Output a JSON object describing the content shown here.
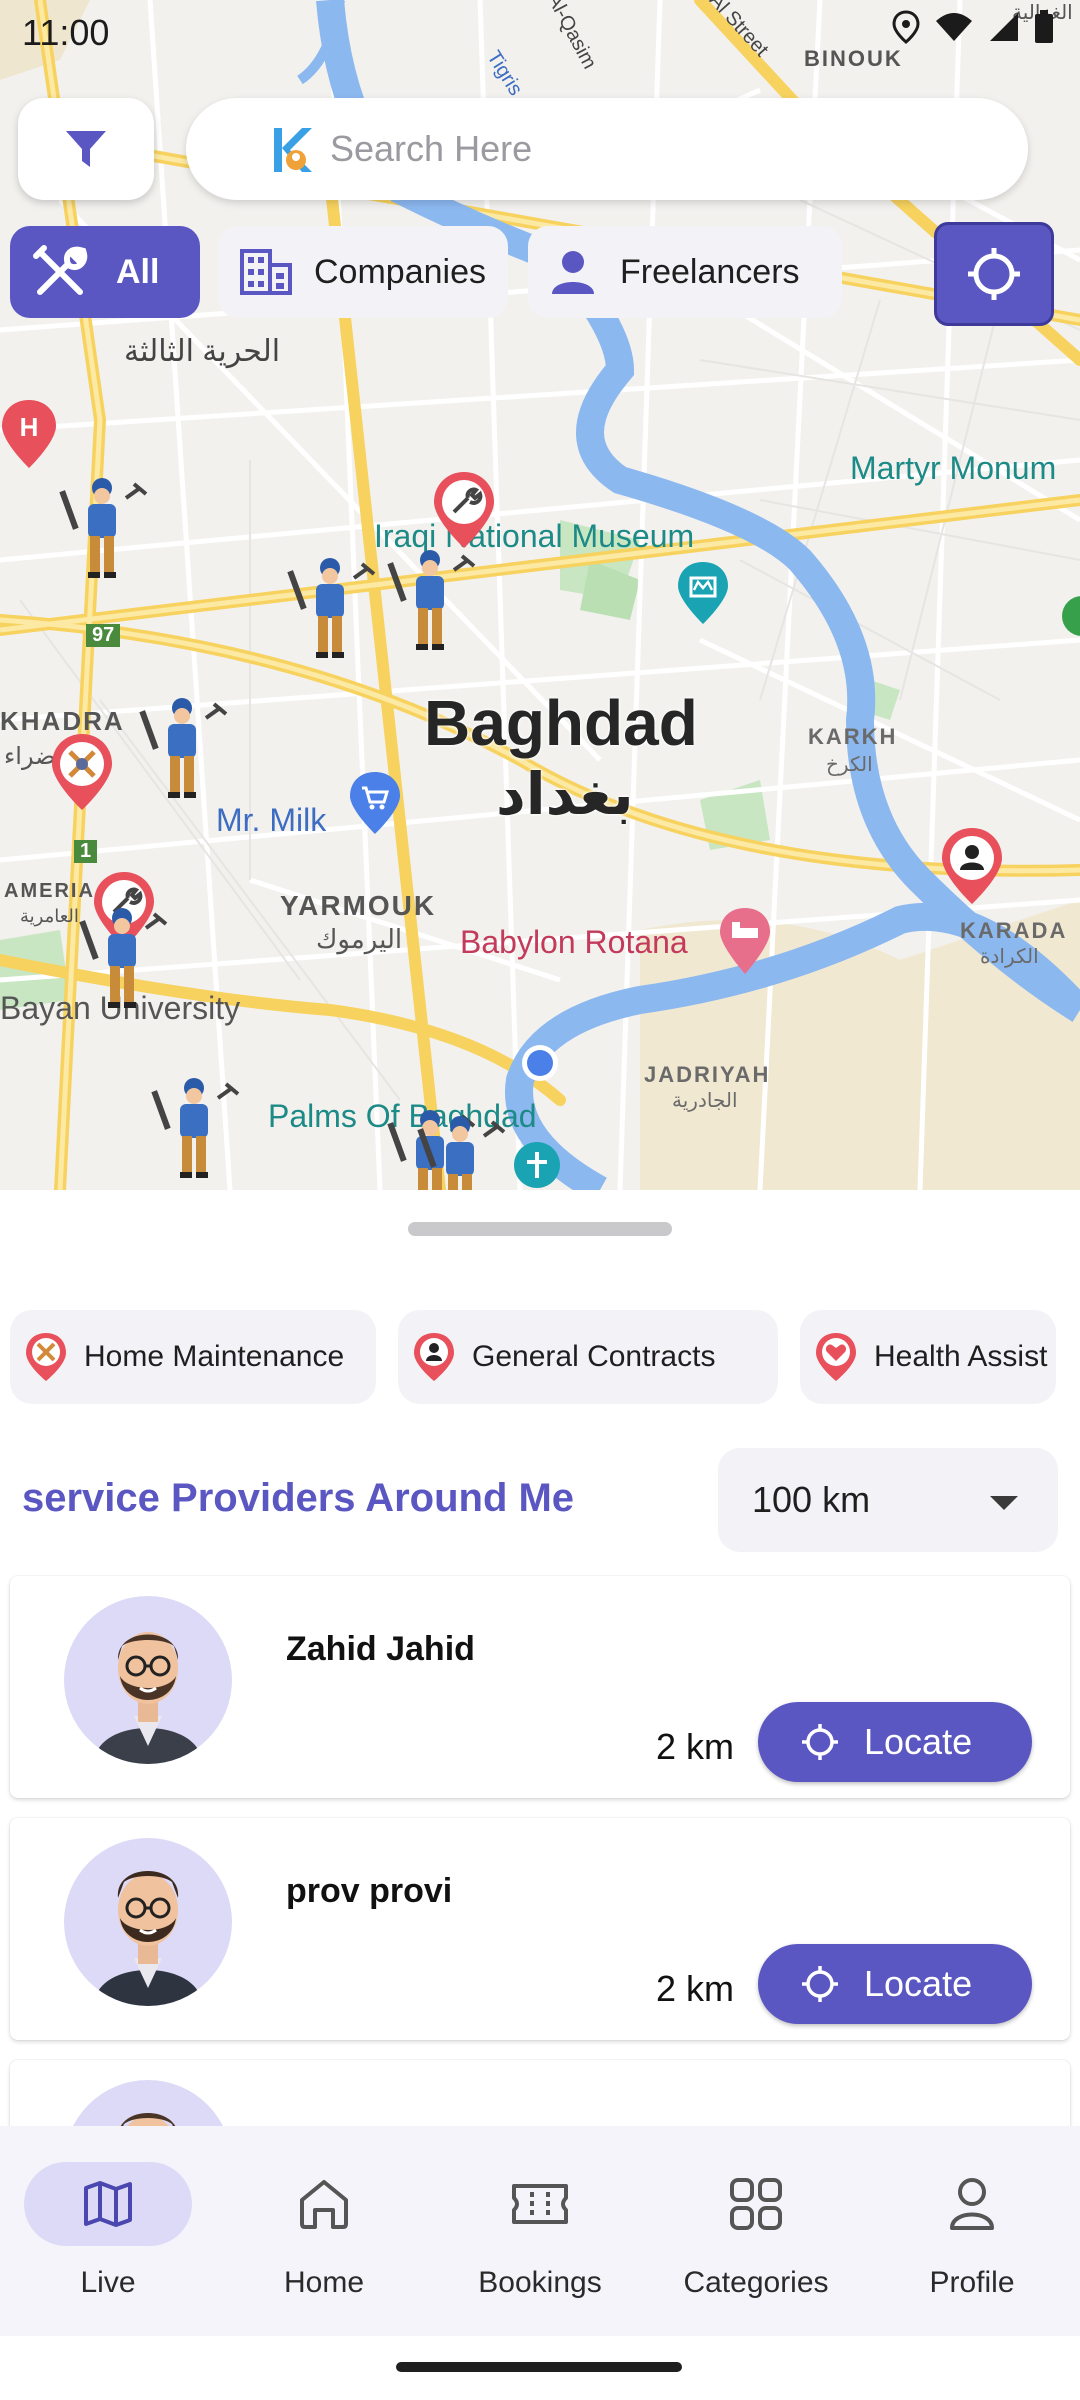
{
  "status_bar": {
    "time": "11:00"
  },
  "search": {
    "placeholder": "Search Here"
  },
  "filters": {
    "all_label": "All",
    "companies_label": "Companies",
    "freelancers_label": "Freelancers"
  },
  "map": {
    "city_name": "Baghdad",
    "city_name_ar": "بغداد",
    "labels": {
      "binouk": "BINOUK",
      "al_hurriya": "الحرية الثالثة",
      "iraqi_museum": "Iraqi National Museum",
      "martyr": "Martyr Monum",
      "karkh": "KARKH",
      "karkh_ar": "الكرخ",
      "khadra": "KHADRA",
      "khadra_ar": "ضراء",
      "mr_milk": "Mr. Milk",
      "yarmouk": "YARMOUK",
      "yarmouk_ar": "اليرموك",
      "babylon": "Babylon Rotana",
      "ameria": "AMERIA",
      "ameria_ar": "العامرية",
      "bayan": "Bayan University",
      "karada": "KARADA",
      "karada_ar": "الكرادة",
      "jadriyah": "JADRIYAH",
      "jadriyah_ar": "الجادرية",
      "palms": "Palms Of Baghdad",
      "road_97": "97",
      "road_1": "1",
      "street_qasim": "Al-Qasim",
      "street_alsi": "Al Street",
      "tigris": "Tigris",
      "ghazaliya": "الغزالية"
    }
  },
  "categories": [
    {
      "label": "Home Maintenance"
    },
    {
      "label": "General Contracts"
    },
    {
      "label": "Health Assist"
    }
  ],
  "section": {
    "title": "service Providers Around Me",
    "distance_selected": "100 km"
  },
  "providers": [
    {
      "name": "Zahid Jahid",
      "distance": "2 km",
      "action": "Locate"
    },
    {
      "name": "prov provi",
      "distance": "2 km",
      "action": "Locate"
    }
  ],
  "nav": {
    "items": [
      {
        "label": "Live"
      },
      {
        "label": "Home"
      },
      {
        "label": "Bookings"
      },
      {
        "label": "Categories"
      },
      {
        "label": "Profile"
      }
    ]
  },
  "colors": {
    "accent": "#5b57c2",
    "accent_light": "#dcdaf6",
    "pin_red": "#e8505b"
  }
}
